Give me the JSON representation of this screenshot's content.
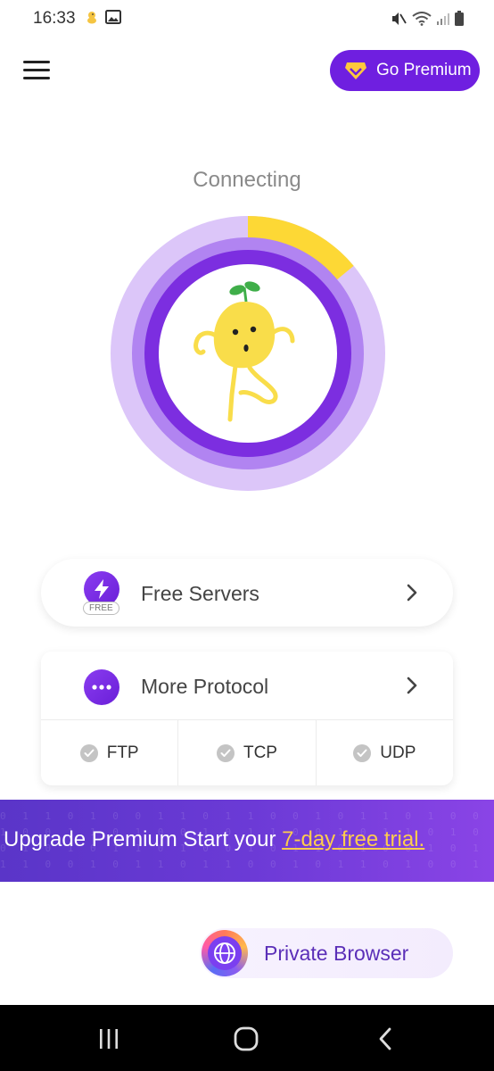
{
  "status_bar": {
    "time": "16:33"
  },
  "header": {
    "menu_icon": "hamburger-icon",
    "premium_label": "Go Premium",
    "premium_icon": "diamond-icon",
    "colors": {
      "premium_bg": "#6f1fe0",
      "diamond": "#ffc83d"
    }
  },
  "connection": {
    "status_text": "Connecting",
    "progress": 0.14,
    "mascot": "bean-sprout-mascot",
    "colors": {
      "ring_outer": "#dcc6f9",
      "ring_mid": "#b184f1",
      "ring_inner": "#7c2ee0",
      "progress": "#fdd835"
    }
  },
  "servers": {
    "label": "Free Servers",
    "badge": "FREE",
    "icon": "lightning-icon"
  },
  "protocol": {
    "label": "More Protocol",
    "icon": "more-dots-icon",
    "options": [
      {
        "label": "FTP"
      },
      {
        "label": "TCP"
      },
      {
        "label": "UDP"
      }
    ]
  },
  "banner": {
    "text": "Upgrade Premium Start your ",
    "link": "7-day free trial."
  },
  "browser": {
    "label": "Private Browser",
    "icon": "globe-icon"
  }
}
